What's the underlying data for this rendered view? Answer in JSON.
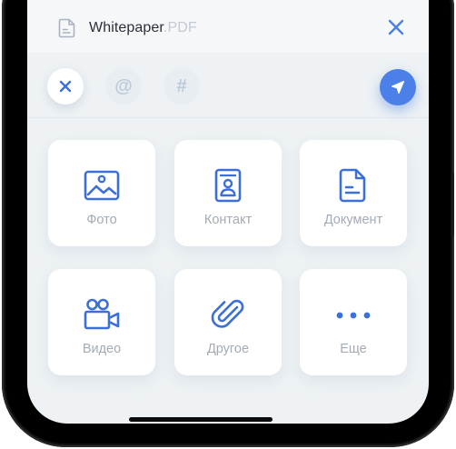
{
  "attachment": {
    "file_name": "Whitepaper",
    "file_ext": ".PDF",
    "file_icon": "document-icon",
    "close_icon": "close-icon"
  },
  "toolbar": {
    "close_icon": "close-icon",
    "mention_glyph": "@",
    "hashtag_glyph": "#",
    "send_icon": "send-arrow-icon"
  },
  "tiles": [
    {
      "label": "Фото",
      "icon": "photo-icon"
    },
    {
      "label": "Контакт",
      "icon": "contact-icon"
    },
    {
      "label": "Документ",
      "icon": "document-icon"
    },
    {
      "label": "Видео",
      "icon": "video-camera-icon"
    },
    {
      "label": "Другое",
      "icon": "paperclip-icon"
    },
    {
      "label": "Еще",
      "icon": "more-dots-icon"
    }
  ],
  "colors": {
    "accent": "#4a80e8",
    "icon": "#3d6fd8",
    "label": "#a3abb6",
    "background": "#eef2f4"
  }
}
